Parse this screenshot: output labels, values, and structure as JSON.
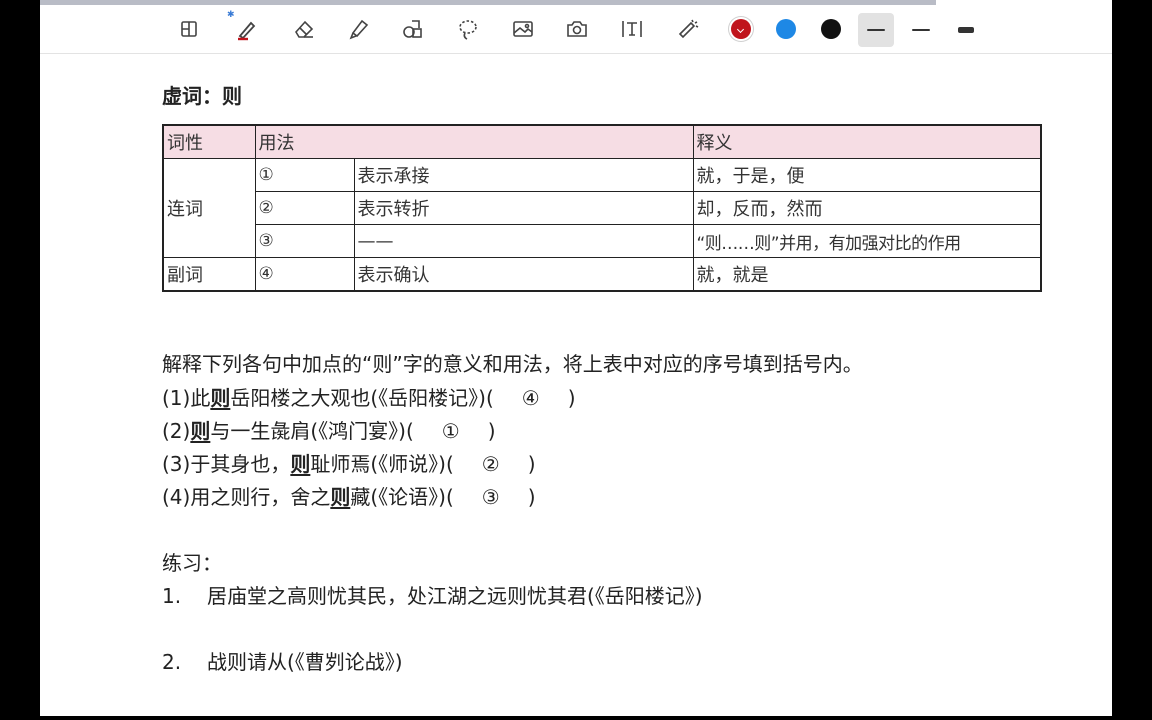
{
  "toolbar": {
    "tools": [
      {
        "name": "page-layout-icon"
      },
      {
        "name": "pen-icon",
        "badge": "bluetooth-icon"
      },
      {
        "name": "eraser-icon"
      },
      {
        "name": "highlighter-icon"
      },
      {
        "name": "shapes-icon"
      },
      {
        "name": "lasso-icon"
      },
      {
        "name": "image-icon"
      },
      {
        "name": "camera-icon"
      },
      {
        "name": "text-tool-icon"
      },
      {
        "name": "laser-pointer-icon"
      }
    ],
    "colors": [
      {
        "name": "color-dark-red",
        "hex": "#c0141c",
        "selected": true
      },
      {
        "name": "color-blue",
        "hex": "#1e88e5",
        "selected": false
      },
      {
        "name": "color-black",
        "hex": "#111111",
        "selected": false
      }
    ],
    "strokes": [
      {
        "name": "stroke-thin",
        "selected": true
      },
      {
        "name": "stroke-medium",
        "selected": false
      },
      {
        "name": "stroke-thick",
        "selected": false
      }
    ]
  },
  "note": {
    "heading": "虚词：则",
    "table": {
      "headers": {
        "pos": "词性",
        "usage": "用法",
        "meaning": "释义"
      },
      "rows": [
        {
          "num": "①",
          "usage": "表示承接",
          "meaning": "就，于是，便"
        },
        {
          "num": "②",
          "usage": "表示转折",
          "meaning": "却，反而，然而"
        },
        {
          "num": "③",
          "usage": "——",
          "meaning": "“则……则”并用，有加强对比的作用"
        },
        {
          "num": "④",
          "usage": "表示确认",
          "meaning": "就，就是"
        }
      ],
      "groups": {
        "conj": "连词",
        "adv": "副词"
      }
    },
    "instruction": "解释下列各句中加点的“则”字的意义和用法，将上表中对应的序号填到括号内。",
    "questions": [
      {
        "pre": "(1)此",
        "kw": "则",
        "post": "岳阳楼之大观也(《岳阳楼记》)(",
        "ans": "④",
        "end": ")"
      },
      {
        "pre": "(2)",
        "kw": "则",
        "post": "与一生彘肩(《鸿门宴》)(",
        "ans": "①",
        "end": ")"
      },
      {
        "pre": "(3)于其身也，",
        "kw": "则",
        "post": "耻师焉(《师说》)(",
        "ans": "②",
        "end": ")"
      },
      {
        "pre": "(4)用之则行，舍之",
        "kw": "则",
        "post": "藏(《论语》)(",
        "ans": "③",
        "end": ")"
      }
    ],
    "exercise": {
      "label": "练习：",
      "items": [
        {
          "num": "1.",
          "text": "居庙堂之高则忧其民，处江湖之远则忧其君(《岳阳楼记》)"
        },
        {
          "num": "2.",
          "text": "战则请从(《曹刿论战》)"
        }
      ]
    }
  }
}
